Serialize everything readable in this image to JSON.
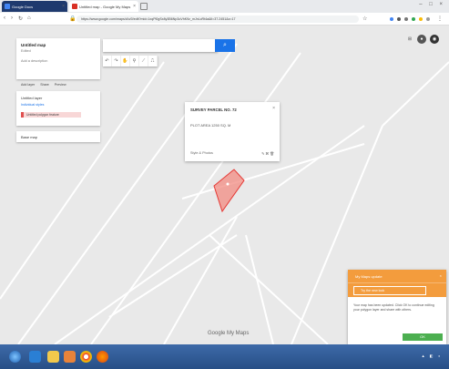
{
  "browser": {
    "tabs": [
      {
        "label": "Google Docs",
        "color": "#4285f4"
      },
      {
        "label": "Untitled map - Google My Maps",
        "color": "#d93025"
      }
    ],
    "url": "https://www.google.com/maps/d/u/0/edit?mid=1xqPl0gSx8y3B6Np3oVhK9z_mJnLcRt4a&ll=37.2451&z=17"
  },
  "left_panel": {
    "map_title": "Untitled map",
    "map_meta": "Edited",
    "map_desc": "Add a description",
    "actions": [
      "Add layer",
      "Share",
      "Preview"
    ],
    "layer_name": "Untitled layer",
    "layer_style": "Individual styles",
    "feature_label": "Untitled polygon feature",
    "basemap": "Base map"
  },
  "draw_tools": [
    "↶",
    "↷",
    "✋",
    "⚲",
    "⟋",
    "⎍"
  ],
  "popup": {
    "title": "SURVEY PARCEL NO. 72",
    "subtitle": "PLOT AREA 1250 SQ. M",
    "footer_left": "Style & Photos",
    "footer_icons": "✎ ⌘ 🗑"
  },
  "map_logo": "Google My Maps",
  "notification": {
    "header": "My Maps update",
    "button": "Try the new look",
    "body": "Your map has been updated. Click OK to continue editing your polygon layer and share with others.",
    "ok": "OK"
  }
}
